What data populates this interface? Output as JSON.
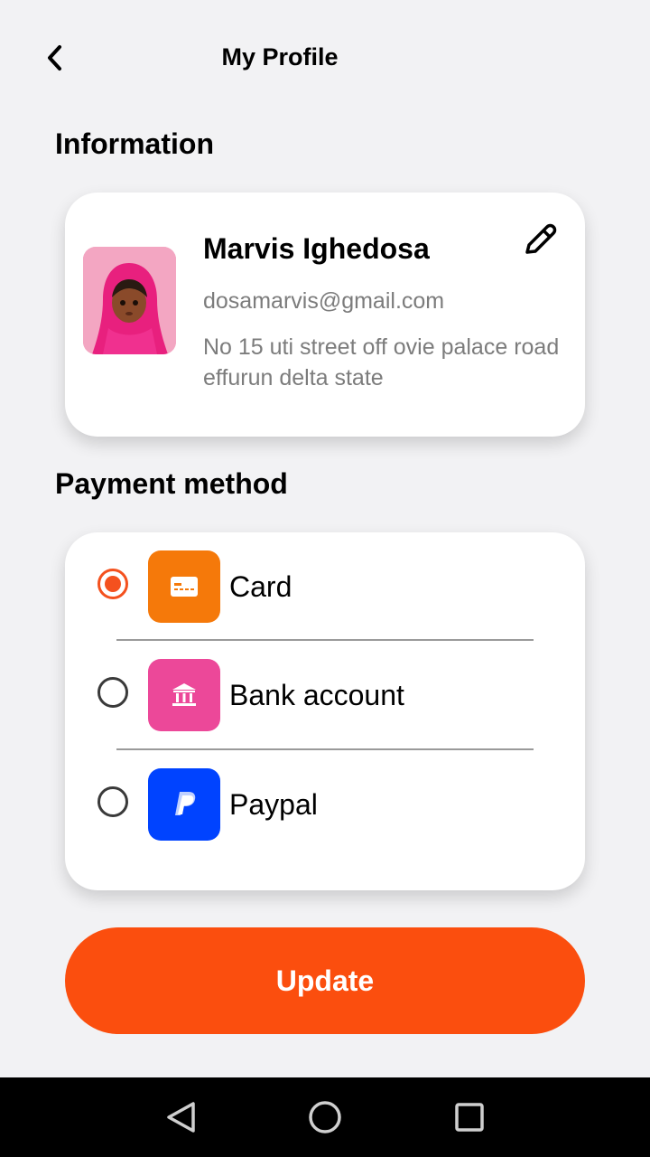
{
  "header": {
    "title": "My Profile",
    "back_icon": "chevron-left-icon"
  },
  "information": {
    "section_title": "Information",
    "name": "Marvis Ighedosa",
    "email": "dosamarvis@gmail.com",
    "address": "No 15 uti street off ovie palace road effurun delta state",
    "edit_icon": "pencil-icon"
  },
  "payment": {
    "section_title": "Payment method",
    "methods": [
      {
        "label": "Card",
        "icon": "credit-card-icon",
        "color": "#f5790a",
        "selected": true
      },
      {
        "label": "Bank account",
        "icon": "bank-icon",
        "color": "#ec4899",
        "selected": false
      },
      {
        "label": "Paypal",
        "icon": "paypal-icon",
        "color": "#0043ff",
        "selected": false
      }
    ],
    "selected_color": "#f4511e"
  },
  "update_button": {
    "label": "Update",
    "color": "#fb4e0e"
  },
  "system_nav": {
    "icons": [
      "back-triangle-icon",
      "home-circle-icon",
      "recents-square-icon"
    ]
  }
}
